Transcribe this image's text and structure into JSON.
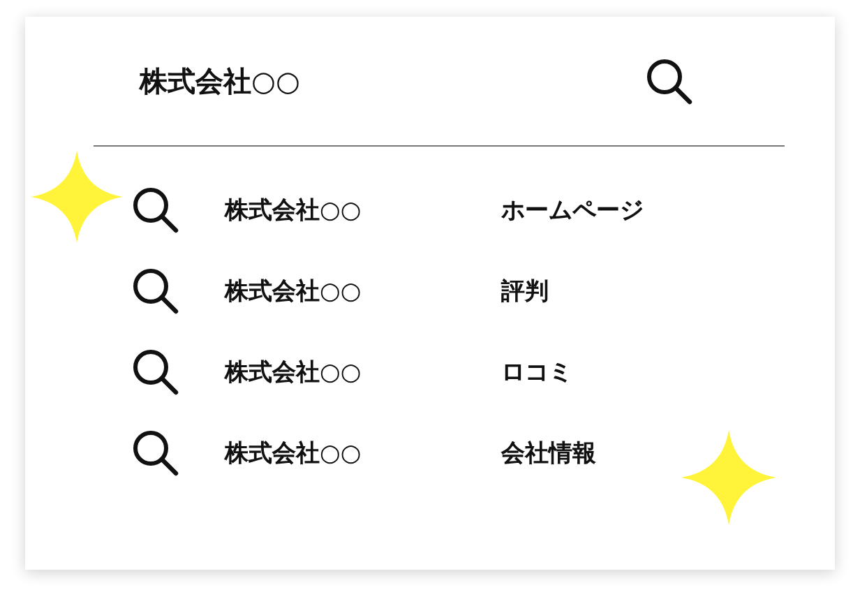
{
  "search": {
    "value": "株式会社○○"
  },
  "suggestions": [
    {
      "company": "株式会社○○",
      "keyword": "ホームページ"
    },
    {
      "company": "株式会社○○",
      "keyword": "評判"
    },
    {
      "company": "株式会社○○",
      "keyword": "ロコミ"
    },
    {
      "company": "株式会社○○",
      "keyword": "会社情報"
    }
  ]
}
